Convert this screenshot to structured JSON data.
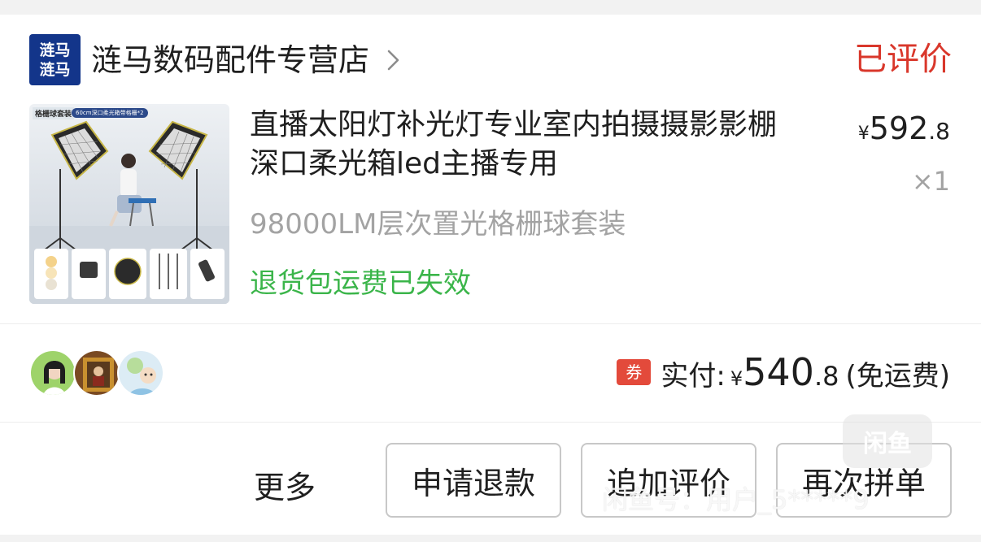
{
  "store": {
    "logo_line1": "涟马",
    "logo_line2": "涟马",
    "name": "涟马数码配件专营店",
    "status": "已评价"
  },
  "product": {
    "thumb_label": "格栅球套装",
    "thumb_badge": "60cm深口柔光箱带格栅*2",
    "title": "直播太阳灯补光灯专业室内拍摄摄影影棚深口柔光箱led主播专用",
    "spec": "98000LM层次置光格栅球套装",
    "return_note": "退货包运费已失效",
    "price_symbol": "¥",
    "price_int": "592",
    "price_dec": ".8",
    "quantity": "×1"
  },
  "payment": {
    "coupon_icon_text": "券",
    "label": "实付:",
    "symbol": "¥",
    "amount_int": "540",
    "amount_dec": ".8",
    "shipping_note": "(免运费)"
  },
  "actions": {
    "more": "更多",
    "refund": "申请退款",
    "add_review": "追加评价",
    "reorder": "再次拼单"
  },
  "watermark": {
    "logo": "闲鱼",
    "text": "闲鱼号：用户_5*****9"
  },
  "colors": {
    "status_red": "#d9372b",
    "return_green": "#3bb54a",
    "spec_gray": "#a3a3a3",
    "logo_blue": "#13358a",
    "coupon_red": "#e34a3b"
  },
  "icons": {
    "store_chevron": "chevron-right-icon",
    "coupon": "coupon-icon"
  }
}
